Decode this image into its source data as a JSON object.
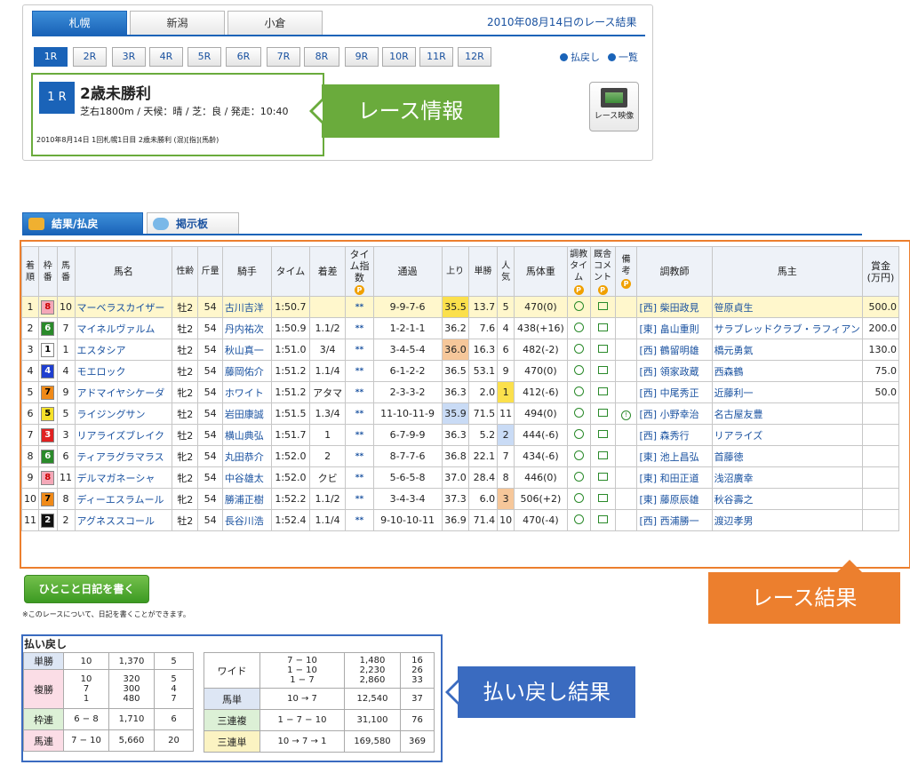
{
  "header": {
    "venue_tabs": [
      "札幌",
      "新潟",
      "小倉"
    ],
    "date_title": "2010年08月14日のレース結果",
    "race_buttons": [
      "1R",
      "2R",
      "3R",
      "4R",
      "5R",
      "6R",
      "7R",
      "8R",
      "9R",
      "10R",
      "11R",
      "12R"
    ],
    "links": {
      "payout": "払戻し",
      "list": "一覧"
    },
    "race_no": "1 R",
    "race_name": "2歳未勝利",
    "race_cond": "芝右1800m / 天候：晴 / 芝：良 / 発走：10:40",
    "race_sub": "2010年8月14日 1回札幌1日目 2歳未勝利 (混)[指](馬齢)",
    "video_label": "レース映像",
    "callout_info": "レース情報"
  },
  "tabs": {
    "result": "結果/払戻",
    "board": "掲示板"
  },
  "results": {
    "headers": [
      "着順",
      "枠番",
      "馬番",
      "馬名",
      "性齢",
      "斤量",
      "騎手",
      "タイム",
      "着差",
      "タイム指数",
      "通過",
      "上り",
      "単勝",
      "人気",
      "馬体重",
      "調教タイム",
      "厩舎コメント",
      "備考",
      "調教師",
      "馬主",
      "賞金(万円)"
    ],
    "rows": [
      {
        "pos": "1",
        "waku": "8",
        "num": "10",
        "name": "マーベラスカイザー",
        "sex": "牡2",
        "kin": "54",
        "jockey": "古川吉洋",
        "time": "1:50.7",
        "diff": "",
        "idx": "**",
        "pass": "9-9-7-6",
        "agari": "35.5",
        "odds": "13.7",
        "pop": "5",
        "weight": "470(0)",
        "biko": "",
        "trainer": "[西] 柴田政見",
        "owner": "笹原貞生",
        "prize": "500.0"
      },
      {
        "pos": "2",
        "waku": "6",
        "num": "7",
        "name": "マイネルヴァルム",
        "sex": "牡2",
        "kin": "54",
        "jockey": "丹内祐次",
        "time": "1:50.9",
        "diff": "1.1/2",
        "idx": "**",
        "pass": "1-2-1-1",
        "agari": "36.2",
        "odds": "7.6",
        "pop": "4",
        "weight": "438(+16)",
        "biko": "",
        "trainer": "[東] 畠山重則",
        "owner": "サラブレッドクラブ・ラフィアン",
        "prize": "200.0"
      },
      {
        "pos": "3",
        "waku": "1",
        "num": "1",
        "name": "エスタシア",
        "sex": "牡2",
        "kin": "54",
        "jockey": "秋山真一",
        "time": "1:51.0",
        "diff": "3/4",
        "idx": "**",
        "pass": "3-4-5-4",
        "agari": "36.0",
        "odds": "16.3",
        "pop": "6",
        "weight": "482(-2)",
        "biko": "",
        "trainer": "[西] 鶴留明雄",
        "owner": "橋元勇氣",
        "prize": "130.0"
      },
      {
        "pos": "4",
        "waku": "4",
        "num": "4",
        "name": "モエロック",
        "sex": "牡2",
        "kin": "54",
        "jockey": "藤岡佑介",
        "time": "1:51.2",
        "diff": "1.1/4",
        "idx": "**",
        "pass": "6-1-2-2",
        "agari": "36.5",
        "odds": "53.1",
        "pop": "9",
        "weight": "470(0)",
        "biko": "",
        "trainer": "[西] 領家政蔵",
        "owner": "西森鶴",
        "prize": "75.0"
      },
      {
        "pos": "5",
        "waku": "7",
        "num": "9",
        "name": "アドマイヤシケーダ",
        "sex": "牝2",
        "kin": "54",
        "jockey": "ホワイト",
        "time": "1:51.2",
        "diff": "アタマ",
        "idx": "**",
        "pass": "2-3-3-2",
        "agari": "36.3",
        "odds": "2.0",
        "pop": "1",
        "weight": "412(-6)",
        "biko": "",
        "trainer": "[西] 中尾秀正",
        "owner": "近藤利一",
        "prize": "50.0"
      },
      {
        "pos": "6",
        "waku": "5",
        "num": "5",
        "name": "ライジングサン",
        "sex": "牡2",
        "kin": "54",
        "jockey": "岩田康誠",
        "time": "1:51.5",
        "diff": "1.3/4",
        "idx": "**",
        "pass": "11-10-11-9",
        "agari": "35.9",
        "odds": "71.5",
        "pop": "11",
        "weight": "494(0)",
        "biko": "!",
        "trainer": "[西] 小野幸治",
        "owner": "名古屋友豊",
        "prize": ""
      },
      {
        "pos": "7",
        "waku": "3",
        "num": "3",
        "name": "リアライズブレイク",
        "sex": "牡2",
        "kin": "54",
        "jockey": "横山典弘",
        "time": "1:51.7",
        "diff": "1",
        "idx": "**",
        "pass": "6-7-9-9",
        "agari": "36.3",
        "odds": "5.2",
        "pop": "2",
        "weight": "444(-6)",
        "biko": "",
        "trainer": "[西] 森秀行",
        "owner": "リアライズ",
        "prize": ""
      },
      {
        "pos": "8",
        "waku": "6",
        "num": "6",
        "name": "ティアラグラマラス",
        "sex": "牝2",
        "kin": "54",
        "jockey": "丸田恭介",
        "time": "1:52.0",
        "diff": "2",
        "idx": "**",
        "pass": "8-7-7-6",
        "agari": "36.8",
        "odds": "22.1",
        "pop": "7",
        "weight": "434(-6)",
        "biko": "",
        "trainer": "[東] 池上昌弘",
        "owner": "首藤徳",
        "prize": ""
      },
      {
        "pos": "9",
        "waku": "8",
        "num": "11",
        "name": "デルマガネーシャ",
        "sex": "牝2",
        "kin": "54",
        "jockey": "中谷雄太",
        "time": "1:52.0",
        "diff": "クビ",
        "idx": "**",
        "pass": "5-6-5-8",
        "agari": "37.0",
        "odds": "28.4",
        "pop": "8",
        "weight": "446(0)",
        "biko": "",
        "trainer": "[東] 和田正道",
        "owner": "浅沼廣幸",
        "prize": ""
      },
      {
        "pos": "10",
        "waku": "7",
        "num": "8",
        "name": "ディーエスラムール",
        "sex": "牝2",
        "kin": "54",
        "jockey": "勝浦正樹",
        "time": "1:52.2",
        "diff": "1.1/2",
        "idx": "**",
        "pass": "3-4-3-4",
        "agari": "37.3",
        "odds": "6.0",
        "pop": "3",
        "weight": "506(+2)",
        "biko": "",
        "trainer": "[東] 藤原辰雄",
        "owner": "秋谷壽之",
        "prize": ""
      },
      {
        "pos": "11",
        "waku": "2",
        "num": "2",
        "name": "アグネススコール",
        "sex": "牡2",
        "kin": "54",
        "jockey": "長谷川浩",
        "time": "1:52.4",
        "diff": "1.1/4",
        "idx": "**",
        "pass": "9-10-10-11",
        "agari": "36.9",
        "odds": "71.4",
        "pop": "10",
        "weight": "470(-4)",
        "biko": "",
        "trainer": "[西] 西浦勝一",
        "owner": "渡辺孝男",
        "prize": ""
      }
    ],
    "callout": "レース結果"
  },
  "diary": {
    "button": "ひとこと日記を書く",
    "note": "※このレースについて、日記を書くことができます。"
  },
  "payout": {
    "title": "払い戻し",
    "tansho": {
      "label": "単勝",
      "num": "10",
      "pay": "1,370",
      "pop": "5"
    },
    "fukusho": {
      "label": "複勝",
      "num": "10\n7\n1",
      "pay": "320\n300\n480",
      "pop": "5\n4\n7"
    },
    "wakuren": {
      "label": "枠連",
      "num": "6 − 8",
      "pay": "1,710",
      "pop": "6"
    },
    "umaren": {
      "label": "馬連",
      "num": "7 − 10",
      "pay": "5,660",
      "pop": "20"
    },
    "wide": {
      "label": "ワイド",
      "num": "7 − 10\n1 − 10\n1 − 7",
      "pay": "1,480\n2,230\n2,860",
      "pop": "16\n26\n33"
    },
    "umatan": {
      "label": "馬単",
      "num": "10 → 7",
      "pay": "12,540",
      "pop": "37"
    },
    "sanrenpuku": {
      "label": "三連複",
      "num": "1 − 7 − 10",
      "pay": "31,100",
      "pop": "76"
    },
    "sanrentan": {
      "label": "三連単",
      "num": "10 → 7 → 1",
      "pay": "169,580",
      "pop": "369"
    },
    "callout": "払い戻し結果"
  },
  "colors": {
    "waku": {
      "1": "#ffffff",
      "2": "#111111",
      "3": "#e02020",
      "4": "#1f3fd0",
      "5": "#f6e12a",
      "6": "#2a8a2a",
      "7": "#f08a18",
      "8": "#f4a8b8"
    }
  }
}
